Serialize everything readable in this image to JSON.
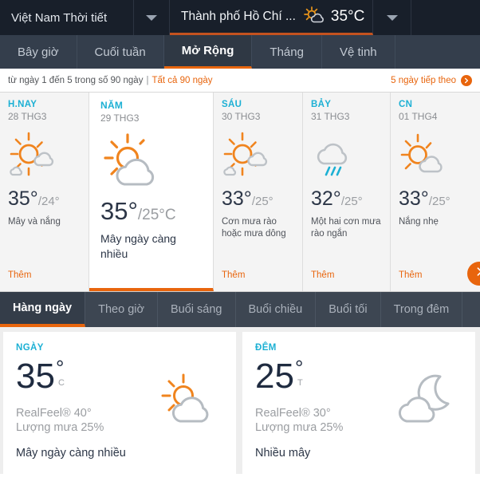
{
  "header": {
    "country_label": "Việt Nam Thời tiết",
    "country_caret_icon": "chevron-down-icon",
    "city_label": "Thành phố Hồ Chí ...",
    "city_weather_icon": "sun-behind-cloud-icon",
    "city_temp": "35°C",
    "city_caret_icon": "chevron-down-icon"
  },
  "main_nav": {
    "items": [
      {
        "label": "Bây giờ",
        "active": false
      },
      {
        "label": "Cuối tuần",
        "active": false
      },
      {
        "label": "Mở Rộng",
        "active": true
      },
      {
        "label": "Tháng",
        "active": false
      },
      {
        "label": "Vệ tinh",
        "active": false
      }
    ]
  },
  "range_bar": {
    "text": "từ ngày 1 đến 5 trong số 90 ngày",
    "separator": "|",
    "all_days_link": "Tất cả 90 ngày",
    "next_link": "5 ngày tiếp theo",
    "next_icon": "circle-arrow-right-icon"
  },
  "forecast": {
    "next_button_icon": "chevron-right-icon",
    "more_label": "Thêm",
    "days": [
      {
        "name": "H.NAY",
        "date": "28 THG3",
        "icon": "sun-behind-cloud-icon",
        "high": "35°",
        "low": "/24°",
        "desc": "Mây và nắng",
        "more": "Thêm",
        "selected": false
      },
      {
        "name": "NĂM",
        "date": "29 THG3",
        "icon": "sun-behind-big-cloud-icon",
        "high": "35°",
        "low": "/25°C",
        "desc": "Mây ngày càng nhiều",
        "more": "",
        "selected": true
      },
      {
        "name": "SÁU",
        "date": "30 THG3",
        "icon": "sun-behind-cloud-icon",
        "high": "33°",
        "low": "/25°",
        "desc": "Cơn mưa rào hoặc mưa dông",
        "more": "Thêm",
        "selected": false
      },
      {
        "name": "BẢY",
        "date": "31 THG3",
        "icon": "cloud-with-rain-icon",
        "high": "32°",
        "low": "/25°",
        "desc": "Một hai cơn mưa rào ngắn",
        "more": "Thêm",
        "selected": false
      },
      {
        "name": "CN",
        "date": "01 THG4",
        "icon": "sun-behind-cloud-icon",
        "high": "33°",
        "low": "/25°",
        "desc": "Nắng nhẹ",
        "more": "Thêm",
        "selected": false
      }
    ]
  },
  "sub_nav": {
    "items": [
      {
        "label": "Hàng ngày",
        "active": true
      },
      {
        "label": "Theo giờ",
        "active": false
      },
      {
        "label": "Buổi sáng",
        "active": false
      },
      {
        "label": "Buổi chiều",
        "active": false
      },
      {
        "label": "Buổi tối",
        "active": false
      },
      {
        "label": "Trong đêm",
        "active": false
      }
    ]
  },
  "detail_panels": {
    "day": {
      "title": "NGÀY",
      "temp": "35",
      "degree": "°",
      "unit": "C",
      "realfeel": "RealFeel® 40°",
      "precip": "Lượng mưa 25%",
      "desc": "Mây ngày càng nhiều",
      "icon": "sun-behind-cloud-icon"
    },
    "night": {
      "title": "ĐÊM",
      "temp": "25",
      "degree": "°",
      "unit": "T",
      "realfeel": "RealFeel® 30°",
      "precip": "Lượng mưa 25%",
      "desc": "Nhiều mây",
      "icon": "moon-behind-cloud-icon"
    }
  },
  "colors": {
    "accent_orange": "#e8650d",
    "cyan": "#1cb0d4",
    "header_dark": "#181f2a",
    "nav_dark": "#343e4c",
    "subnav_dark": "#3d4652",
    "text_dark": "#2c3647",
    "text_muted": "#9a9da1"
  }
}
